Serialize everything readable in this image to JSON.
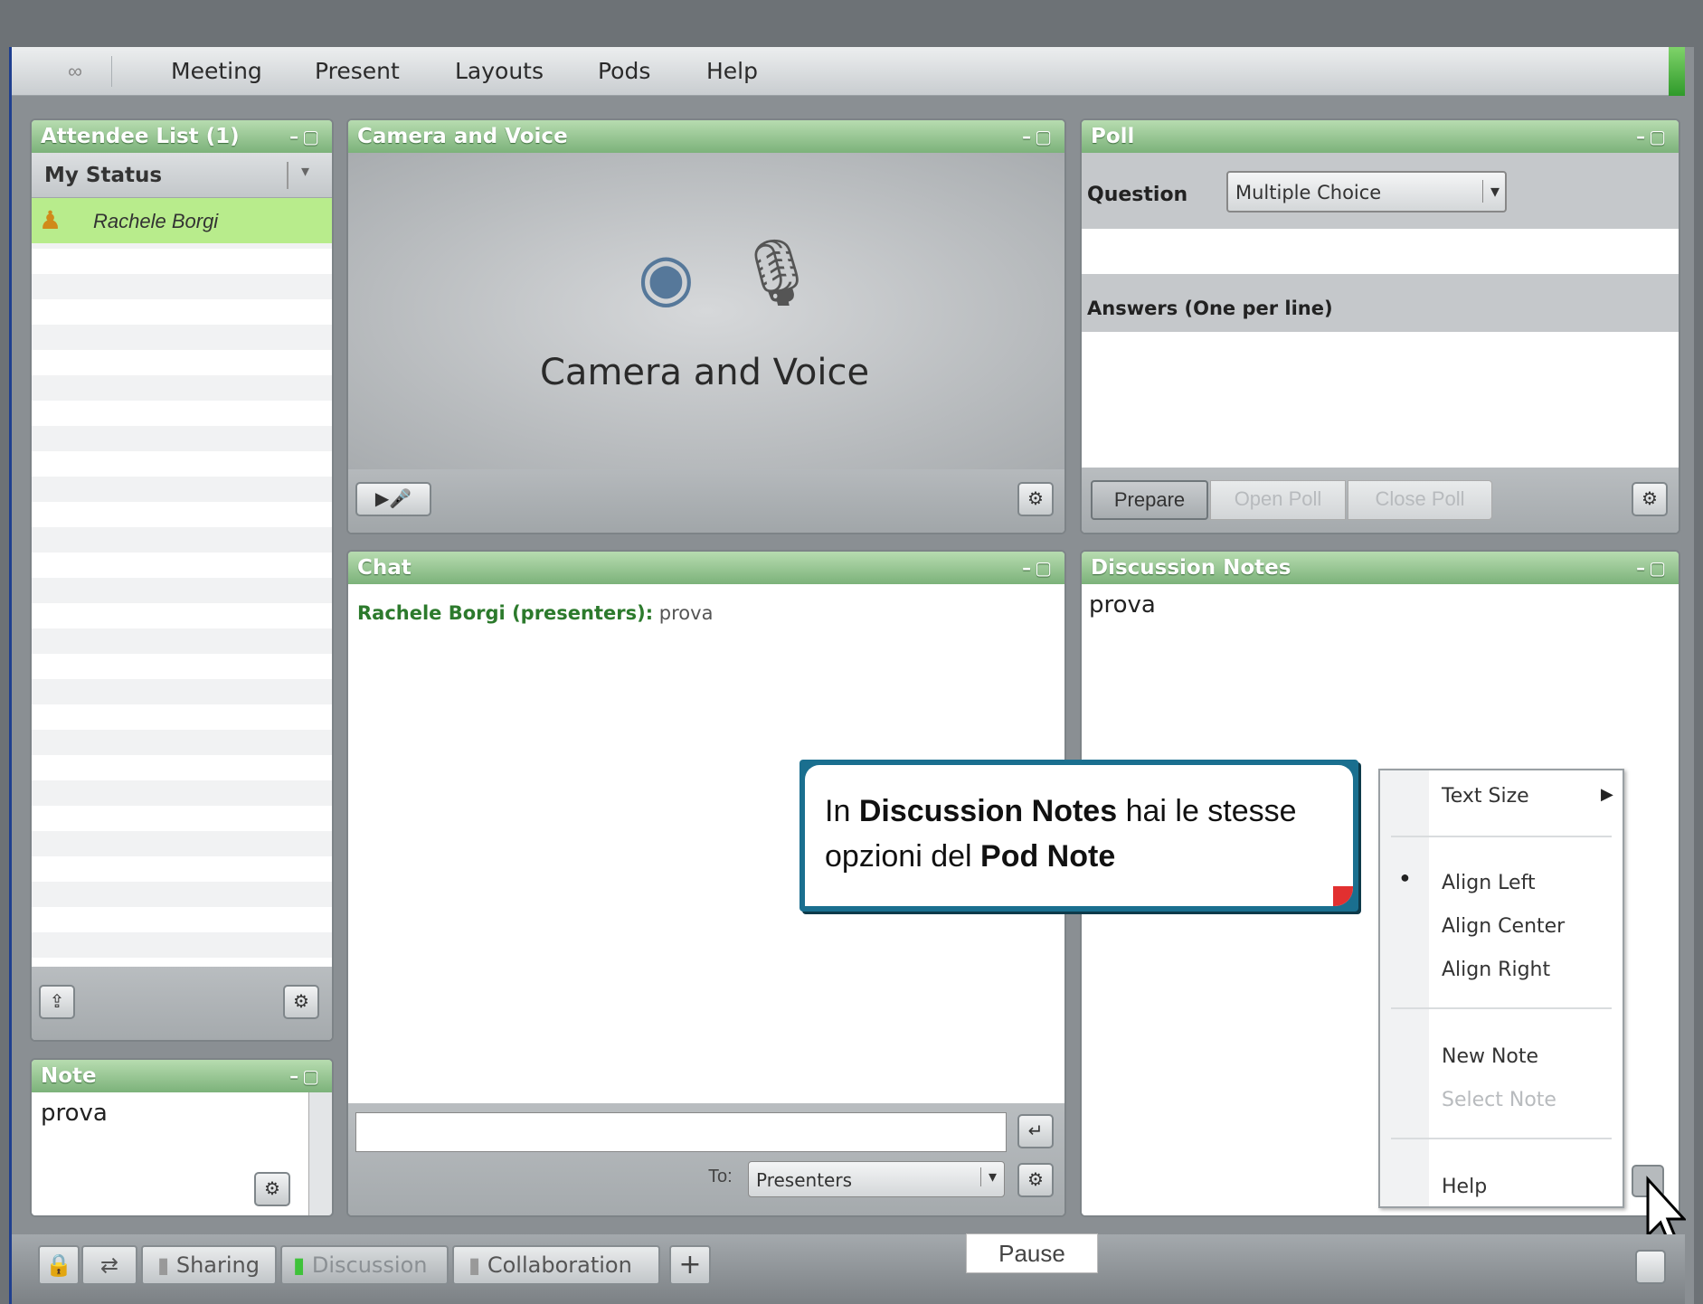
{
  "menubar": {
    "items": [
      "Meeting",
      "Present",
      "Layouts",
      "Pods",
      "Help"
    ]
  },
  "attendee_pod": {
    "title": "Attendee List (1)",
    "status_label": "My Status",
    "attendee_name": "Rachele Borgi"
  },
  "camera_pod": {
    "title": "Camera and Voice",
    "label": "Camera and Voice"
  },
  "poll_pod": {
    "title": "Poll",
    "question_label": "Question",
    "type_select": "Multiple Choice",
    "answers_label": "Answers (One per line)",
    "prepare": "Prepare",
    "open_poll": "Open Poll",
    "close_poll": "Close Poll"
  },
  "chat_pod": {
    "title": "Chat",
    "sender": "Rachele Borgi (presenters):",
    "message": " prova",
    "to_label": "To:",
    "to_select": "Presenters"
  },
  "notes_pod": {
    "title": "Discussion Notes",
    "content": "prova"
  },
  "note_pod": {
    "title": "Note",
    "content": "prova"
  },
  "callout": {
    "part1": "In ",
    "bold1": "Discussion Notes",
    "part2": " hai le stesse opzioni del ",
    "bold2": "Pod Note"
  },
  "context_menu": {
    "text_size": "Text Size",
    "align_left": "Align Left",
    "align_center": "Align Center",
    "align_right": "Align Right",
    "new_note": "New Note",
    "select_note": "Select Note",
    "help": "Help"
  },
  "bottom_tabs": {
    "sharing": "Sharing",
    "discussion": "Discussion",
    "collaboration": "Collaboration",
    "add": "+"
  },
  "pause_label": "Pause",
  "colors": {
    "pod_header": "#7cb27a",
    "attendee_highlight": "#b8ec8c",
    "chat_sender": "#2c7a2c"
  }
}
